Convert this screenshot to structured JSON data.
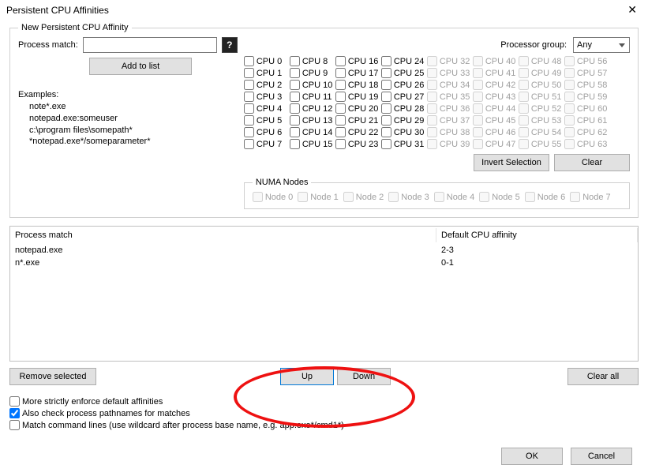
{
  "title": "Persistent CPU Affinities",
  "group": {
    "legend": "New Persistent CPU Affinity",
    "process_match_label": "Process match:",
    "process_match_value": "",
    "add_to_list": "Add to list",
    "examples_label": "Examples:",
    "examples": [
      "note*.exe",
      "notepad.exe:someuser",
      "c:\\program files\\somepath*",
      "*notepad.exe*/someparameter*"
    ],
    "processor_group_label": "Processor group:",
    "processor_group_value": "Any",
    "cpu_labels": {
      "0": "CPU 0",
      "1": "CPU 1",
      "2": "CPU 2",
      "3": "CPU 3",
      "4": "CPU 4",
      "5": "CPU 5",
      "6": "CPU 6",
      "7": "CPU 7",
      "8": "CPU 8",
      "9": "CPU 9",
      "10": "CPU 10",
      "11": "CPU 11",
      "12": "CPU 12",
      "13": "CPU 13",
      "14": "CPU 14",
      "15": "CPU 15",
      "16": "CPU 16",
      "17": "CPU 17",
      "18": "CPU 18",
      "19": "CPU 19",
      "20": "CPU 20",
      "21": "CPU 21",
      "22": "CPU 22",
      "23": "CPU 23",
      "24": "CPU 24",
      "25": "CPU 25",
      "26": "CPU 26",
      "27": "CPU 27",
      "28": "CPU 28",
      "29": "CPU 29",
      "30": "CPU 30",
      "31": "CPU 31",
      "32": "CPU 32",
      "33": "CPU 33",
      "34": "CPU 34",
      "35": "CPU 35",
      "36": "CPU 36",
      "37": "CPU 37",
      "38": "CPU 38",
      "39": "CPU 39",
      "40": "CPU 40",
      "41": "CPU 41",
      "42": "CPU 42",
      "43": "CPU 43",
      "44": "CPU 44",
      "45": "CPU 45",
      "46": "CPU 46",
      "47": "CPU 47",
      "48": "CPU 48",
      "49": "CPU 49",
      "50": "CPU 50",
      "51": "CPU 51",
      "52": "CPU 52",
      "53": "CPU 53",
      "54": "CPU 54",
      "55": "CPU 55",
      "56": "CPU 56",
      "57": "CPU 57",
      "58": "CPU 58",
      "59": "CPU 59",
      "60": "CPU 60",
      "61": "CPU 61",
      "62": "CPU 62",
      "63": "CPU 63"
    },
    "cpu_enabled_max": 31,
    "invert_selection": "Invert Selection",
    "clear": "Clear",
    "numa_legend": "NUMA Nodes",
    "numa_labels": [
      "Node 0",
      "Node 1",
      "Node 2",
      "Node 3",
      "Node 4",
      "Node 5",
      "Node 6",
      "Node 7"
    ]
  },
  "table": {
    "col_match": "Process match",
    "col_affinity": "Default CPU affinity",
    "rows": [
      {
        "match": "notepad.exe",
        "affinity": "2-3"
      },
      {
        "match": "n*.exe",
        "affinity": "0-1"
      }
    ]
  },
  "buttons": {
    "remove_selected": "Remove selected",
    "up": "Up",
    "down": "Down",
    "clear_all": "Clear all",
    "ok": "OK",
    "cancel": "Cancel"
  },
  "options": {
    "strict": "More strictly enforce default affinities",
    "paths": "Also check process pathnames for matches",
    "cmdlines": "Match command lines (use wildcard after process base name, e.g. app.exe*/cmd1*)",
    "strict_checked": false,
    "paths_checked": true,
    "cmdlines_checked": false
  }
}
